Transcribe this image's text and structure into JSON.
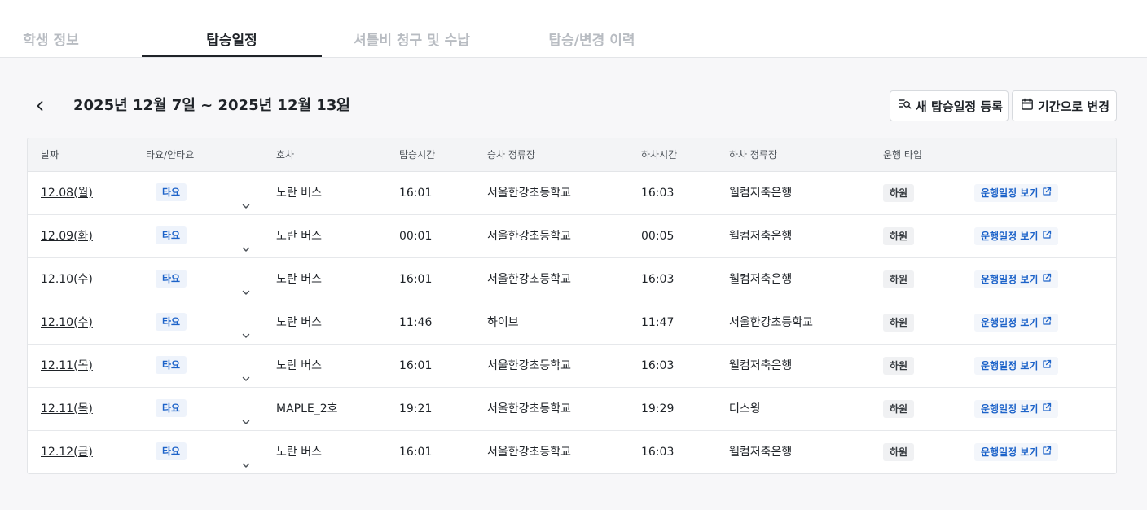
{
  "tabs": [
    {
      "label": "학생 정보",
      "active": false
    },
    {
      "label": "탑승일정",
      "active": true
    },
    {
      "label": "셔틀비 청구 및 수납",
      "active": false
    },
    {
      "label": "탑승/변경 이력",
      "active": false
    }
  ],
  "range": {
    "label": "2025년 12월 7일 ~ 2025년 12월 13일"
  },
  "actions": {
    "new_schedule": "새 탑승일정 등록",
    "change_period": "기간으로 변경"
  },
  "table": {
    "columns": [
      "날짜",
      "타요/안타요",
      "호차",
      "탑승시간",
      "승차 정류장",
      "하차시간",
      "하차 정류장",
      "운행 타입"
    ],
    "rows": [
      {
        "date": "12.08(월)",
        "ride": "타요",
        "bus": "노란 버스",
        "board_time": "16:01",
        "board_stop": "서울한강초등학교",
        "alight_time": "16:03",
        "alight_stop": "웰컴저축은행",
        "type": "하원",
        "link": "운행일정 보기"
      },
      {
        "date": "12.09(화)",
        "ride": "타요",
        "bus": "노란 버스",
        "board_time": "00:01",
        "board_stop": "서울한강초등학교",
        "alight_time": "00:05",
        "alight_stop": "웰컴저축은행",
        "type": "하원",
        "link": "운행일정 보기"
      },
      {
        "date": "12.10(수)",
        "ride": "타요",
        "bus": "노란 버스",
        "board_time": "16:01",
        "board_stop": "서울한강초등학교",
        "alight_time": "16:03",
        "alight_stop": "웰컴저축은행",
        "type": "하원",
        "link": "운행일정 보기"
      },
      {
        "date": "12.10(수)",
        "ride": "타요",
        "bus": "노란 버스",
        "board_time": "11:46",
        "board_stop": "하이브",
        "alight_time": "11:47",
        "alight_stop": "서울한강초등학교",
        "type": "하원",
        "link": "운행일정 보기"
      },
      {
        "date": "12.11(목)",
        "ride": "타요",
        "bus": "노란 버스",
        "board_time": "16:01",
        "board_stop": "서울한강초등학교",
        "alight_time": "16:03",
        "alight_stop": "웰컴저축은행",
        "type": "하원",
        "link": "운행일정 보기"
      },
      {
        "date": "12.11(목)",
        "ride": "타요",
        "bus": "MAPLE_2호",
        "board_time": "19:21",
        "board_stop": "서울한강초등학교",
        "alight_time": "19:29",
        "alight_stop": "더스윙",
        "type": "하원",
        "link": "운행일정 보기"
      },
      {
        "date": "12.12(금)",
        "ride": "타요",
        "bus": "노란 버스",
        "board_time": "16:01",
        "board_stop": "서울한강초등학교",
        "alight_time": "16:03",
        "alight_stop": "웰컴저축은행",
        "type": "하원",
        "link": "운행일정 보기"
      }
    ]
  },
  "colors": {
    "accent": "#1d63c9",
    "badge_bg": "#eef3fb",
    "header_bg": "#f3f4f6",
    "page_bg": "#f7f7f9"
  },
  "icons": {
    "prev": "chevron-left-icon",
    "next": "chevron-right-icon",
    "new_schedule": "list-search-icon",
    "change_period": "calendar-icon",
    "ride_dropdown": "chevron-down-icon",
    "link": "external-link-icon"
  }
}
